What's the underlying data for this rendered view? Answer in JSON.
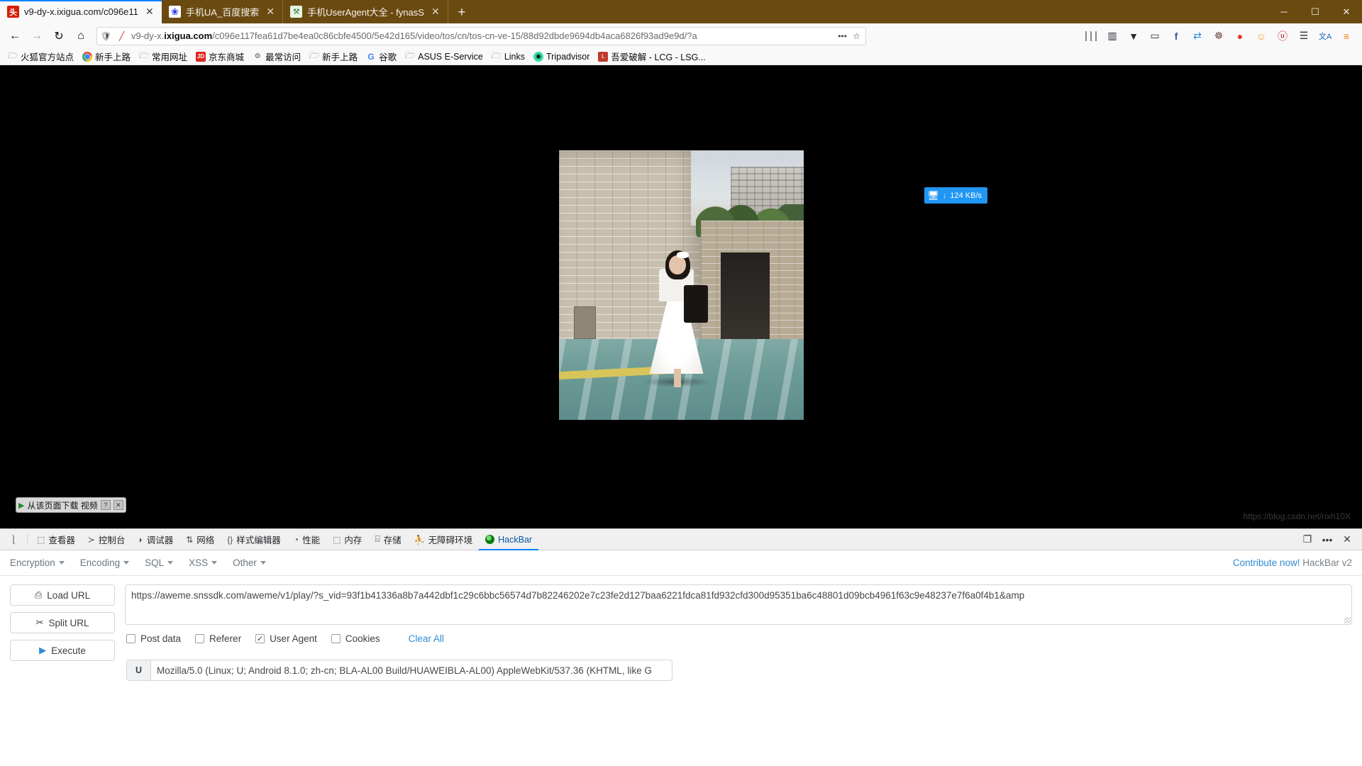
{
  "window": {
    "minimize": "─",
    "maximize": "☐",
    "close": "✕"
  },
  "tabs": [
    {
      "title": "v9-dy-x.ixigua.com/c096e11",
      "favicon": "ixigua-favicon",
      "favicon_glyph": "头",
      "close": "✕",
      "active": true
    },
    {
      "title": "手机UA_百度搜索",
      "favicon": "baidu-favicon",
      "favicon_glyph": "❀",
      "close": "✕",
      "active": false
    },
    {
      "title": "手机UserAgent大全 - fynasS",
      "favicon": "fynas-favicon",
      "favicon_glyph": "⚒",
      "close": "✕",
      "active": false
    }
  ],
  "newtab_label": "+",
  "nav": {
    "back": "←",
    "forward": "→",
    "reload": "↻",
    "home": "⌂",
    "shield_icon": "shield-icon",
    "tracking_icon": "tracking-blocked-icon",
    "url_host": "v9-dy-x.",
    "url_host_bold": "ixigua.com",
    "url_path": "/c096e117fea61d7be4ea0c86cbfe4500/5e42d165/video/tos/cn/tos-cn-ve-15/88d92dbde9694db4aca6826f93ad9e9d/?a",
    "more_label": "•••",
    "bookmark_star": "☆"
  },
  "toolbar_icons": [
    {
      "name": "library-icon",
      "glyph": "∣∣∣"
    },
    {
      "name": "sidebar-icon",
      "glyph": "▥"
    },
    {
      "name": "pocket-icon",
      "glyph": "▼"
    },
    {
      "name": "chat-icon",
      "glyph": "▭"
    },
    {
      "name": "facebook-container-icon",
      "glyph": "f"
    },
    {
      "name": "refresh-extension-icon",
      "glyph": "⇄"
    },
    {
      "name": "proxy-extension-icon",
      "glyph": "☸"
    },
    {
      "name": "adblock-icon",
      "glyph": "●"
    },
    {
      "name": "smiley-extension-icon",
      "glyph": "☺"
    },
    {
      "name": "ublock-icon",
      "glyph": "ⓤ"
    },
    {
      "name": "reader-extension-icon",
      "glyph": "☰"
    },
    {
      "name": "translate-extension-icon",
      "glyph": "文A"
    },
    {
      "name": "app-menu-icon",
      "glyph": "≡"
    }
  ],
  "bookmarks": [
    {
      "label": "火狐官方站点",
      "icon": "folder-icon"
    },
    {
      "label": "新手上路",
      "icon": "chrome-icon"
    },
    {
      "label": "常用网址",
      "icon": "folder-icon"
    },
    {
      "label": "京东商城",
      "icon": "jd-icon"
    },
    {
      "label": "最常访问",
      "icon": "gear-icon"
    },
    {
      "label": "新手上路",
      "icon": "folder-icon"
    },
    {
      "label": "谷歌",
      "icon": "google-icon"
    },
    {
      "label": "ASUS E-Service",
      "icon": "folder-icon"
    },
    {
      "label": "Links",
      "icon": "folder-icon"
    },
    {
      "label": "Tripadvisor",
      "icon": "tripadvisor-icon"
    },
    {
      "label": "吾爱破解 - LCG - LSG...",
      "icon": "lcg-icon"
    }
  ],
  "page": {
    "speed_badge": {
      "icon": "network-speed-icon",
      "arrow": "↓",
      "value": "124 KB/s"
    },
    "download_bar": {
      "play_icon": "▶",
      "label": "从该页面下载 视频",
      "help": "?",
      "close": "✕"
    },
    "watermark": "https://blog.csdn.net/nxh10X"
  },
  "devtools": {
    "picker_icon": "element-picker-icon",
    "tabs": [
      {
        "label": "查看器",
        "icon": "inspector-icon",
        "glyph": "⬚",
        "active": false
      },
      {
        "label": "控制台",
        "icon": "console-icon",
        "glyph": "≻",
        "active": false
      },
      {
        "label": "调试器",
        "icon": "debugger-icon",
        "glyph": "◗",
        "active": false
      },
      {
        "label": "网络",
        "icon": "network-icon",
        "glyph": "⇅",
        "active": false
      },
      {
        "label": "样式编辑器",
        "icon": "style-editor-icon",
        "glyph": "{}",
        "active": false
      },
      {
        "label": "性能",
        "icon": "performance-icon",
        "glyph": "◔",
        "active": false
      },
      {
        "label": "内存",
        "icon": "memory-icon",
        "glyph": "⬚",
        "active": false
      },
      {
        "label": "存储",
        "icon": "storage-icon",
        "glyph": "⌸",
        "active": false
      },
      {
        "label": "无障碍环境",
        "icon": "accessibility-icon",
        "glyph": "⛹",
        "active": false
      },
      {
        "label": "HackBar",
        "icon": "hackbar-icon",
        "glyph": "",
        "active": true
      }
    ],
    "right_buttons": [
      {
        "name": "responsive-design-mode-icon",
        "glyph": "❐"
      },
      {
        "name": "devtools-options-icon",
        "glyph": "•••"
      },
      {
        "name": "devtools-close-icon",
        "glyph": "✕"
      }
    ]
  },
  "hackbar": {
    "menu": [
      {
        "label": "Encryption"
      },
      {
        "label": "Encoding"
      },
      {
        "label": "SQL"
      },
      {
        "label": "XSS"
      },
      {
        "label": "Other"
      }
    ],
    "contribute_link": "Contribute now!",
    "contribute_suffix": " HackBar v2",
    "buttons": [
      {
        "label": "Load URL",
        "icon": "load-url-icon",
        "glyph": "⎙"
      },
      {
        "label": "Split URL",
        "icon": "split-url-icon",
        "glyph": "✂"
      },
      {
        "label": "Execute",
        "icon": "execute-icon",
        "glyph": "▶"
      }
    ],
    "url_value": "https://aweme.snssdk.com/aweme/v1/play/?s_vid=93f1b41336a8b7a442dbf1c29c6bbc56574d7b82246202e7c23fe2d127baa6221fdca81fd932cfd300d95351ba6c48801d09bcb4961f63c9e48237e7f6a0f4b1&amp",
    "checkboxes": [
      {
        "label": "Post data",
        "checked": false,
        "mark": ""
      },
      {
        "label": "Referer",
        "checked": false,
        "mark": ""
      },
      {
        "label": "User Agent",
        "checked": true,
        "mark": "✓"
      },
      {
        "label": "Cookies",
        "checked": false,
        "mark": ""
      }
    ],
    "clear_all": "Clear All",
    "ua_prefix_label": "U",
    "ua_value": "Mozilla/5.0 (Linux; U; Android 8.1.0; zh-cn; BLA-AL00 Build/HUAWEIBLA-AL00) AppleWebKit/537.36 (KHTML, like G"
  }
}
